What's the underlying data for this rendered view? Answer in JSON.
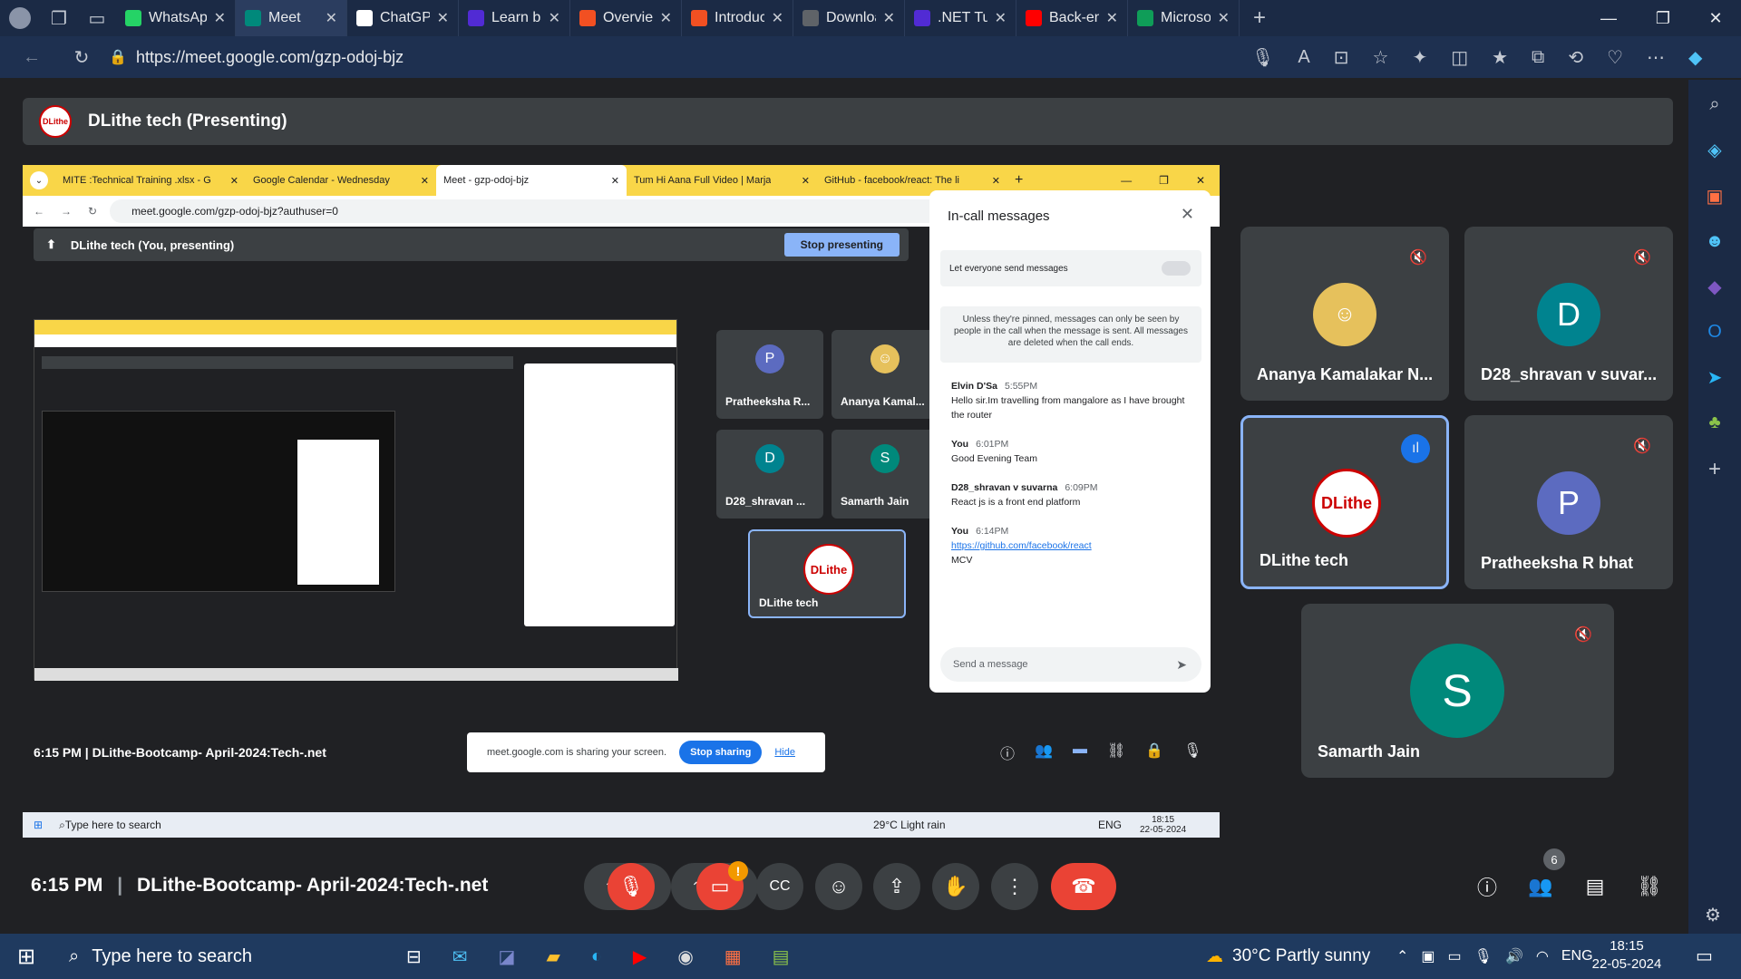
{
  "browser": {
    "tabs": [
      {
        "label": "WhatsApp",
        "color": "#25d366"
      },
      {
        "label": "Meet",
        "color": "#00897b"
      },
      {
        "label": "ChatGPT",
        "color": "#ffffff"
      },
      {
        "label": "Learn bac",
        "color": "#512bd4"
      },
      {
        "label": "Overview",
        "color": "#f25022"
      },
      {
        "label": "Introducti",
        "color": "#f25022"
      },
      {
        "label": "Download",
        "color": "#5f6368"
      },
      {
        "label": ".NET Tuto",
        "color": "#512bd4"
      },
      {
        "label": "Back-end",
        "color": "#ff0000"
      },
      {
        "label": "Microsoft",
        "color": "#0f9d58"
      }
    ],
    "url": "https://meet.google.com/gzp-odoj-bjz"
  },
  "meet": {
    "presenter_title": "DLithe tech (Presenting)",
    "logo_text": "DLithe",
    "time": "6:15 PM",
    "meeting_name": "DLithe-Bootcamp- April-2024:Tech-.net",
    "participants_count": "6",
    "participants": [
      {
        "name": "Ananya Kamalakar N...",
        "initial": "",
        "color": "#e6c15c"
      },
      {
        "name": "D28_shravan v suvar...",
        "initial": "D",
        "color": "#00838f"
      },
      {
        "name": "DLithe tech",
        "initial": "",
        "color": "#ffffff"
      },
      {
        "name": "Pratheeksha R bhat",
        "initial": "P",
        "color": "#5c6bc0"
      },
      {
        "name": "Samarth Jain",
        "initial": "S",
        "color": "#00897b"
      }
    ],
    "notif_badge": "!"
  },
  "shared": {
    "tabs": [
      "MITE :Technical Training .xlsx - G",
      "Google Calendar - Wednesday",
      "Meet - gzp-odoj-bjz",
      "Tum Hi Aana Full Video | Marja",
      "GitHub - facebook/react: The li"
    ],
    "url": "meet.google.com/gzp-odoj-bjz?authuser=0",
    "present_label": "DLithe tech (You, presenting)",
    "stop_presenting": "Stop presenting",
    "chat": {
      "title": "In-call messages",
      "toggle_label": "Let everyone send messages",
      "notice": "Unless they're pinned, messages can only be seen by people in the call when the message is sent. All messages are deleted when the call ends.",
      "messages": [
        {
          "sender": "Elvin D'Sa",
          "time": "5:55PM",
          "text": "Hello sir.Im travelling from mangalore as I have brought the router"
        },
        {
          "sender": "You",
          "time": "6:01PM",
          "text": "Good Evening Team"
        },
        {
          "sender": "D28_shravan v suvarna",
          "time": "6:09PM",
          "text": "React js is a front end platform"
        },
        {
          "sender": "You",
          "time": "6:14PM",
          "text": "https://github.com/facebook/react",
          "extra": "MCV"
        }
      ],
      "placeholder": "Send a message"
    },
    "tiles": [
      {
        "name": "Pratheeksha R...",
        "initial": "P",
        "color": "#5c6bc0"
      },
      {
        "name": "Ananya Kamal...",
        "initial": "",
        "color": "#e6c15c"
      },
      {
        "name": "D28_shravan ...",
        "initial": "D",
        "color": "#00838f"
      },
      {
        "name": "Samarth Jain",
        "initial": "S",
        "color": "#00897b"
      },
      {
        "name": "DLithe tech",
        "initial": "",
        "color": "#ffffff"
      }
    ],
    "time": "6:15 PM",
    "meeting_name": "DLithe-Bootcamp- April-2024:Tech-.net",
    "count": "6",
    "share_notice": "meet.google.com is sharing your screen.",
    "stop_sharing": "Stop sharing",
    "hide": "Hide",
    "taskbar": {
      "search": "Type here to search",
      "weather": "29°C  Light rain",
      "lang": "ENG",
      "clock_time": "18:15",
      "clock_date": "22-05-2024"
    }
  },
  "taskbar": {
    "search": "Type here to search",
    "weather": "30°C  Partly sunny",
    "lang": "ENG",
    "clock_time": "18:15",
    "clock_date": "22-05-2024"
  }
}
